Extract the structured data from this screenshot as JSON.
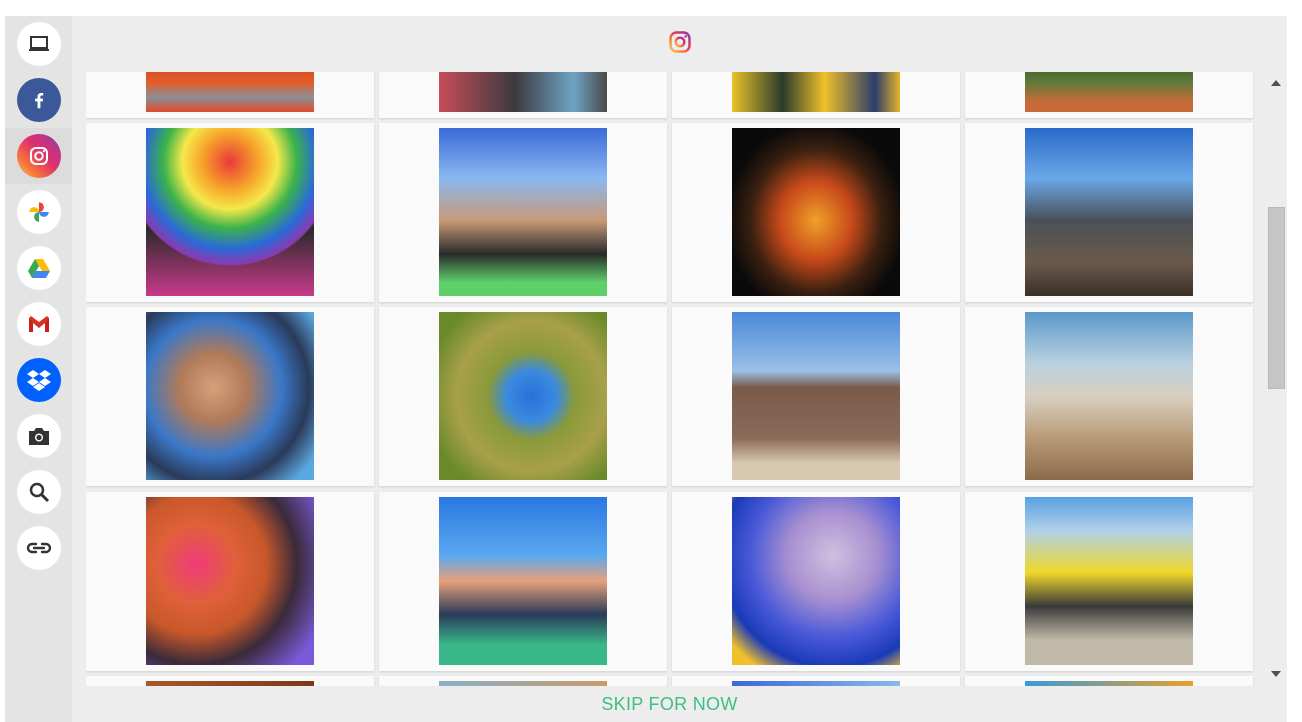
{
  "sidebar": {
    "items": [
      {
        "name": "laptop",
        "icon": "laptop-icon",
        "active": false
      },
      {
        "name": "facebook",
        "icon": "facebook-icon",
        "active": false,
        "color": "#3b5998"
      },
      {
        "name": "instagram",
        "icon": "instagram-icon",
        "active": true
      },
      {
        "name": "google-photos",
        "icon": "google-photos-icon",
        "active": false
      },
      {
        "name": "google-drive",
        "icon": "google-drive-icon",
        "active": false
      },
      {
        "name": "gmail",
        "icon": "gmail-icon",
        "active": false
      },
      {
        "name": "dropbox",
        "icon": "dropbox-icon",
        "active": false,
        "color": "#0061fe"
      },
      {
        "name": "camera",
        "icon": "camera-icon",
        "active": false
      },
      {
        "name": "search",
        "icon": "search-icon",
        "active": false
      },
      {
        "name": "link",
        "icon": "link-icon",
        "active": false
      }
    ]
  },
  "header": {
    "icon": "instagram-icon"
  },
  "photos": {
    "count_visible_rows": 5,
    "columns": 4
  },
  "footer": {
    "skip_label": "SKIP FOR NOW"
  },
  "colors": {
    "accent_green": "#3cbf82",
    "facebook_blue": "#3b5998",
    "dropbox_blue": "#0061fe"
  }
}
